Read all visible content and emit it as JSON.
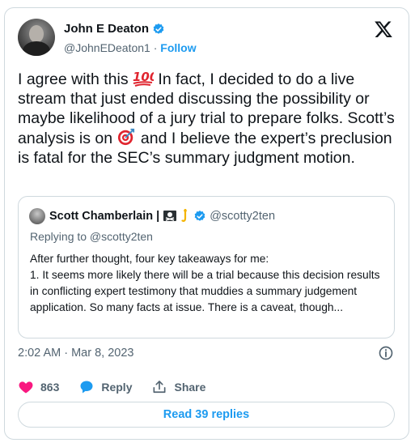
{
  "author": {
    "name": "John E Deaton",
    "handle": "@JohnEDeaton1",
    "separator": "·",
    "follow_label": "Follow"
  },
  "tweet": {
    "part1": "I agree with this ",
    "part2": " In fact, I decided to do a live stream that just ended discussing the possibility or maybe likelihood of a jury trial to prepare folks. Scott’s analysis is on ",
    "part3": " and I believe the expert’s preclusion is fatal for the SEC’s summary judgment motion.",
    "emoji_hundred": "100-emoji",
    "emoji_target": "target-emoji"
  },
  "quote": {
    "name": "Scott Chamberlain |",
    "flags": [
      "pirate-flag-emoji",
      "hook-emoji"
    ],
    "handle": "@scotty2ten",
    "replying_to": "Replying to @scotty2ten",
    "body": "After further thought, four key takeaways for me:\n1. It seems more likely there will be a trial because this decision results in conflicting expert testimony that muddies a summary judgement application. So many facts at issue. There is a caveat, though..."
  },
  "meta": {
    "timestamp": "2:02 AM · Mar 8, 2023"
  },
  "actions": {
    "likes": "863",
    "reply_label": "Reply",
    "share_label": "Share"
  },
  "read_replies_label": "Read 39 replies",
  "colors": {
    "accent": "#1d9bf0",
    "like": "#f91880",
    "text": "#0f1419",
    "muted": "#536471",
    "border": "#cfd9de"
  }
}
